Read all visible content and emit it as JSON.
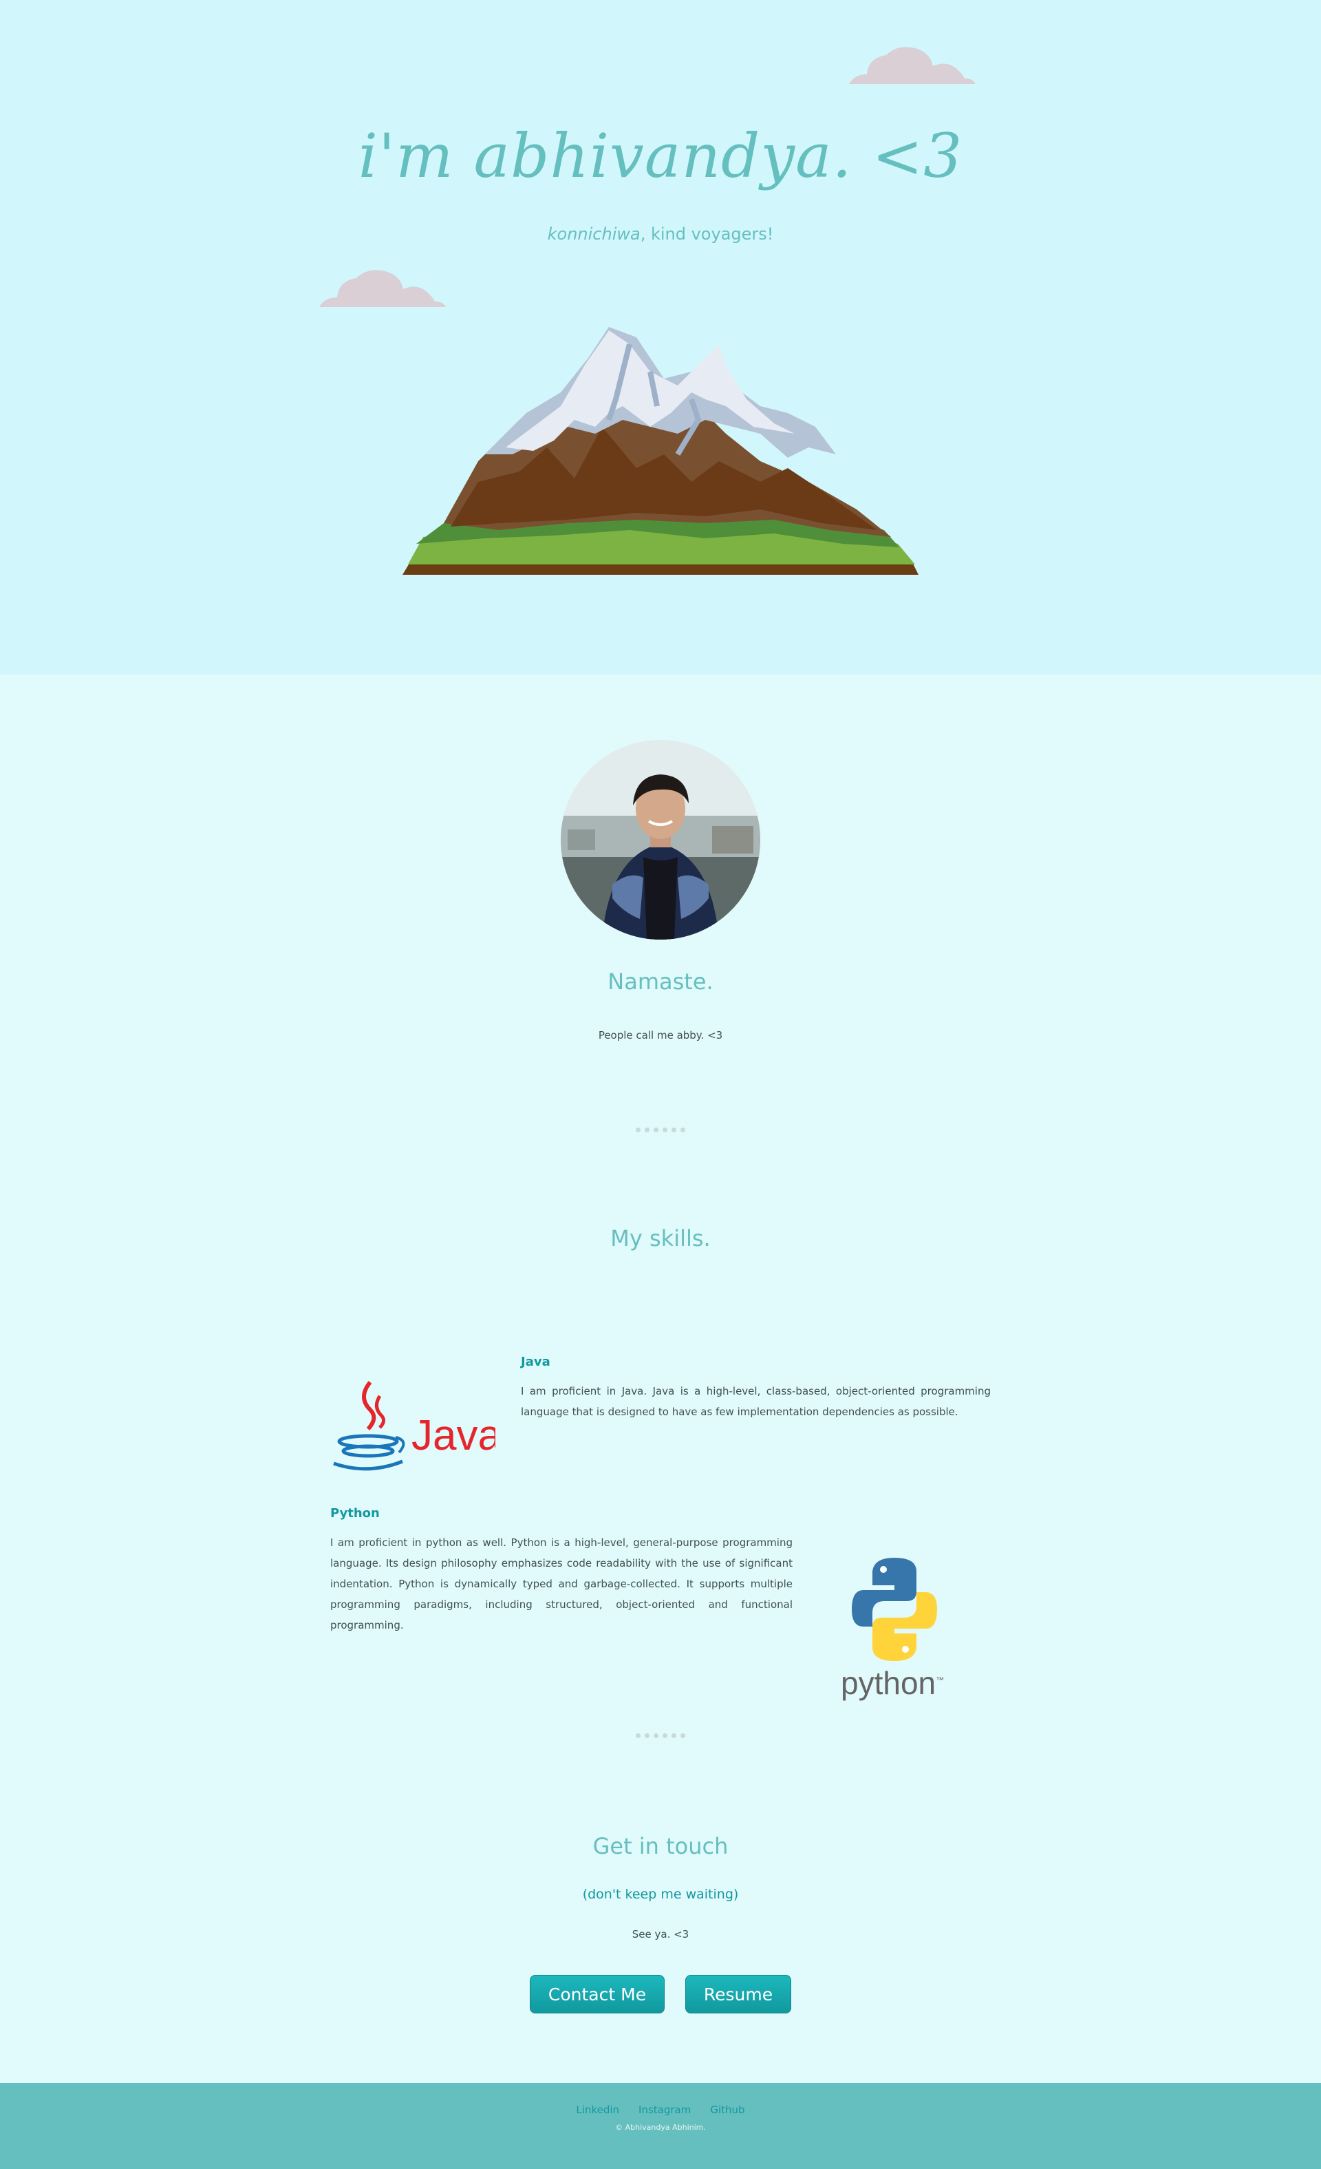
{
  "hero": {
    "title": "i'm abhivandya. <3",
    "subtitle_em": "konnichiwa",
    "subtitle_rest": ", kind voyagers!"
  },
  "profile": {
    "heading": "Namaste.",
    "text": "People call me abby. <3"
  },
  "skills": {
    "heading": "My skills.",
    "items": [
      {
        "name": "Java",
        "description": "I am proficient in Java. Java is a high-level, class-based, object-oriented programming language that is designed to have as few implementation dependencies as possible.",
        "logo_text": "Java"
      },
      {
        "name": "Python",
        "description": "I am proficient in python as well. Python is a high-level, general-purpose programming language. Its design philosophy emphasizes code readability with the use of significant indentation. Python is dynamically typed and garbage-collected. It supports multiple programming paradigms, including structured, object-oriented and functional programming.",
        "logo_text": "python",
        "logo_tm": "™"
      }
    ]
  },
  "contact": {
    "heading": "Get in touch",
    "subheading": "(don't keep me waiting)",
    "text": "See ya. <3",
    "buttons": {
      "contact": "Contact Me",
      "resume": "Resume"
    }
  },
  "footer": {
    "links": [
      "Linkedin",
      "Instagram",
      "Github"
    ],
    "copyright": "© Abhivandya Abhinim."
  },
  "colors": {
    "hero_bg": "#d1f7fc",
    "page_bg": "#e1fafc",
    "accent": "#66bfbf",
    "accent_dark": "#11999e",
    "text": "#40514e",
    "cloud": "#d9cfd5"
  }
}
